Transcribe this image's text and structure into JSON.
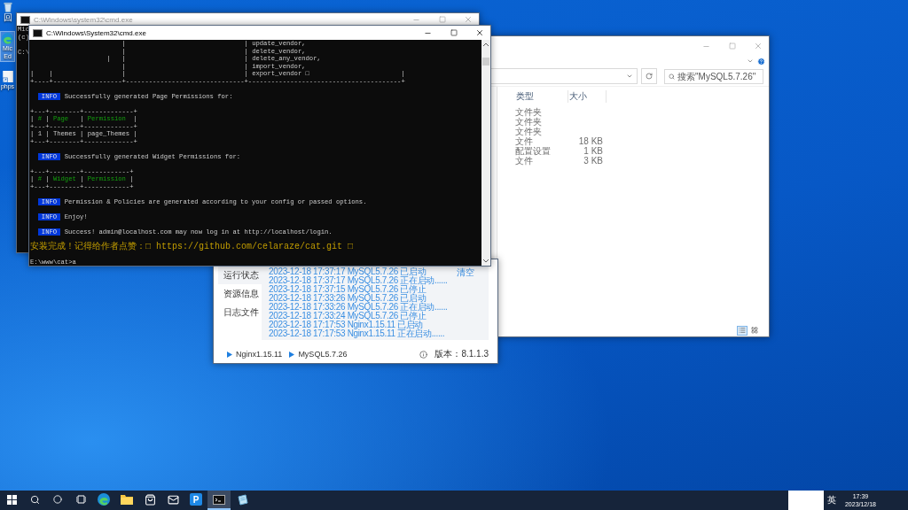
{
  "desktop_icons": [
    {
      "kind": "recycle",
      "lines": [
        "回"
      ],
      "selected": false
    },
    {
      "kind": "edge",
      "lines": [
        "Mic",
        "Ed"
      ],
      "selected": true
    },
    {
      "kind": "shortcut",
      "lines": [
        "phps"
      ],
      "selected": false
    }
  ],
  "back_console": {
    "title": "C:\\Windows\\system32\\cmd.exe",
    "active": false,
    "lines": [
      {
        "kind": "text",
        "segments": [
          {
            "kind": "plain",
            "text": "Mic"
          }
        ]
      },
      {
        "kind": "text",
        "segments": [
          {
            "kind": "plain",
            "text": "(c)"
          }
        ]
      },
      {
        "kind": "blank"
      },
      {
        "kind": "text",
        "segments": [
          {
            "kind": "plain",
            "text": "C:\\"
          }
        ]
      }
    ]
  },
  "explorer": {
    "search": {
      "placeholder": "搜索\"MySQL5.7.26\""
    },
    "columns": [
      "类型",
      "大小"
    ],
    "rows": [
      {
        "type": "文件夹"
      },
      {
        "type": "文件夹"
      },
      {
        "type": "文件夹"
      },
      {
        "type": "文件",
        "size": "18 KB"
      },
      {
        "type": "配置设置",
        "size": "1 KB"
      },
      {
        "type": "文件",
        "size": "3 KB"
      }
    ]
  },
  "phpstudy": {
    "nav": [
      {
        "label": "运行状态",
        "selected": true
      },
      {
        "label": "资源信息",
        "selected": false
      },
      {
        "label": "日志文件",
        "selected": false
      }
    ],
    "logs": [
      "2023-12-18 17:37:17 MySQL5.7.26 已启动",
      "2023-12-18 17:37:17 MySQL5.7.26 正在启动......",
      "2023-12-18 17:37:15 MySQL5.7.26 已停止",
      "2023-12-18 17:33:26 MySQL5.7.26 已启动",
      "2023-12-18 17:33:26 MySQL5.7.26 正在启动......",
      "2023-12-18 17:33:24 MySQL5.7.26 已停止",
      "2023-12-18 17:17:53 Nginx1.15.11 已启动",
      "2023-12-18 17:17:53 Nginx1.15.11 正在启动......"
    ],
    "clear": "清空",
    "services": [
      "Nginx1.15.11",
      "MySQL5.7.26"
    ],
    "version": "版本：8.1.1.3"
  },
  "console": {
    "title": "C:\\Windows\\System32\\cmd.exe",
    "active": true,
    "lines": [
      {
        "kind": "text",
        "segments": [
          {
            "kind": "plain",
            "text": "                        |                               | update_vendor,"
          }
        ]
      },
      {
        "kind": "text",
        "segments": [
          {
            "kind": "plain",
            "text": "                        |                               | delete_vendor,"
          }
        ]
      },
      {
        "kind": "text",
        "segments": [
          {
            "kind": "plain",
            "text": "                    |   |                               | delete_any_vendor,"
          }
        ]
      },
      {
        "kind": "text",
        "segments": [
          {
            "kind": "plain",
            "text": "                        |                               | import_vendor,"
          }
        ]
      },
      {
        "kind": "text",
        "segments": [
          {
            "kind": "plain",
            "text": "|    |                  |                               | export_vendor □                        |"
          }
        ]
      },
      {
        "kind": "text",
        "segments": [
          {
            "kind": "plain",
            "text": "+----+------------------+-------------------------------+----------------------------------------+"
          }
        ]
      },
      {
        "kind": "blank"
      },
      {
        "kind": "text",
        "segments": [
          {
            "kind": "badge",
            "text": " INFO "
          },
          {
            "kind": "plain",
            "text": " Successfully generated Page Permissions for:"
          }
        ]
      },
      {
        "kind": "blank"
      },
      {
        "kind": "text",
        "segments": [
          {
            "kind": "plain",
            "text": "+---+--------+-------------+"
          }
        ]
      },
      {
        "kind": "text",
        "segments": [
          {
            "kind": "plain",
            "text": "| "
          },
          {
            "kind": "green",
            "text": "#"
          },
          {
            "kind": "plain",
            "text": " | "
          },
          {
            "kind": "green",
            "text": "Page"
          },
          {
            "kind": "plain",
            "text": "   | "
          },
          {
            "kind": "green",
            "text": "Permission"
          },
          {
            "kind": "plain",
            "text": "  |"
          }
        ]
      },
      {
        "kind": "text",
        "segments": [
          {
            "kind": "plain",
            "text": "+---+--------+-------------+"
          }
        ]
      },
      {
        "kind": "text",
        "segments": [
          {
            "kind": "plain",
            "text": "| 1 | Themes | page_Themes |"
          }
        ]
      },
      {
        "kind": "text",
        "segments": [
          {
            "kind": "plain",
            "text": "+---+--------+-------------+"
          }
        ]
      },
      {
        "kind": "blank"
      },
      {
        "kind": "text",
        "segments": [
          {
            "kind": "badge",
            "text": " INFO "
          },
          {
            "kind": "plain",
            "text": " Successfully generated Widget Permissions for:"
          }
        ]
      },
      {
        "kind": "blank"
      },
      {
        "kind": "text",
        "segments": [
          {
            "kind": "plain",
            "text": "+---+--------+------------+"
          }
        ]
      },
      {
        "kind": "text",
        "segments": [
          {
            "kind": "plain",
            "text": "| "
          },
          {
            "kind": "green",
            "text": "#"
          },
          {
            "kind": "plain",
            "text": " | "
          },
          {
            "kind": "green",
            "text": "Widget"
          },
          {
            "kind": "plain",
            "text": " | "
          },
          {
            "kind": "green",
            "text": "Permission"
          },
          {
            "kind": "plain",
            "text": " |"
          }
        ]
      },
      {
        "kind": "text",
        "segments": [
          {
            "kind": "plain",
            "text": "+---+--------+------------+"
          }
        ]
      },
      {
        "kind": "blank"
      },
      {
        "kind": "text",
        "segments": [
          {
            "kind": "badge",
            "text": " INFO "
          },
          {
            "kind": "plain",
            "text": " Permission & Policies are generated according to your config or passed options."
          }
        ]
      },
      {
        "kind": "blank"
      },
      {
        "kind": "text",
        "segments": [
          {
            "kind": "badge",
            "text": " INFO "
          },
          {
            "kind": "plain",
            "text": " Enjoy!"
          }
        ]
      },
      {
        "kind": "blank"
      },
      {
        "kind": "text",
        "segments": [
          {
            "kind": "badge",
            "text": " INFO "
          },
          {
            "kind": "plain",
            "text": " Success! admin@localhost.com may now log in at http://localhost/login."
          }
        ]
      },
      {
        "kind": "blank"
      },
      {
        "kind": "text",
        "segments": [
          {
            "kind": "yellow",
            "text": "安装完成！记得给作者点赞：□ https://github.com/celaraze/cat.git □"
          }
        ]
      },
      {
        "kind": "blank"
      },
      {
        "kind": "text",
        "segments": [
          {
            "kind": "plain",
            "text": "E:\\www\\cat>a"
          }
        ]
      }
    ]
  },
  "taskbar": {
    "apps": [
      {
        "kind": "start",
        "selected": false
      },
      {
        "kind": "search",
        "selected": false
      },
      {
        "kind": "cortana",
        "selected": false
      },
      {
        "kind": "taskview",
        "selected": false
      },
      {
        "kind": "edge",
        "selected": false
      },
      {
        "kind": "folder",
        "selected": false
      },
      {
        "kind": "store",
        "selected": false
      },
      {
        "kind": "mail",
        "selected": false
      },
      {
        "kind": "phpstudy",
        "glyph": "P",
        "selected": false
      },
      {
        "kind": "console",
        "selected": true
      },
      {
        "kind": "notepad",
        "selected": false
      }
    ],
    "ime": "英",
    "time": "17:39",
    "date": "2023/12/18"
  }
}
